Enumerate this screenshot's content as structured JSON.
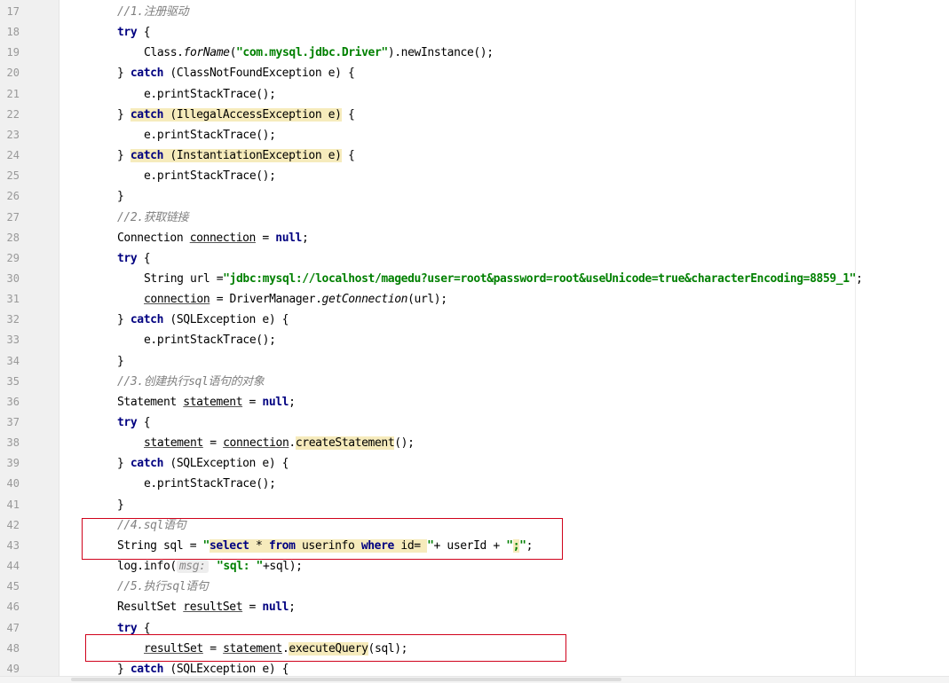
{
  "editor": {
    "lines": [
      {
        "n": "17",
        "indent": 1,
        "segs": [
          {
            "t": "//1.注册驱动",
            "c": "com"
          }
        ]
      },
      {
        "n": "18",
        "indent": 1,
        "segs": [
          {
            "t": "try",
            "c": "kw"
          },
          {
            "t": " {",
            "c": ""
          }
        ]
      },
      {
        "n": "19",
        "indent": 2,
        "segs": [
          {
            "t": "Class.",
            "c": ""
          },
          {
            "t": "forName",
            "c": "it"
          },
          {
            "t": "(",
            "c": ""
          },
          {
            "t": "\"com.mysql.jdbc.Driver\"",
            "c": "str"
          },
          {
            "t": ").newInstance();",
            "c": ""
          }
        ]
      },
      {
        "n": "20",
        "indent": 1,
        "segs": [
          {
            "t": "} ",
            "c": ""
          },
          {
            "t": "catch",
            "c": "kw"
          },
          {
            "t": " (ClassNotFoundException e) {",
            "c": ""
          }
        ]
      },
      {
        "n": "21",
        "indent": 2,
        "segs": [
          {
            "t": "e.printStackTrace();",
            "c": ""
          }
        ]
      },
      {
        "n": "22",
        "indent": 1,
        "segs": [
          {
            "t": "} ",
            "c": ""
          },
          {
            "t": "catch",
            "c": "kw hl"
          },
          {
            "t": " (IllegalAccessException e)",
            "c": "hl"
          },
          {
            "t": " {",
            "c": ""
          }
        ]
      },
      {
        "n": "23",
        "indent": 2,
        "segs": [
          {
            "t": "e.printStackTrace();",
            "c": ""
          }
        ]
      },
      {
        "n": "24",
        "indent": 1,
        "segs": [
          {
            "t": "} ",
            "c": ""
          },
          {
            "t": "catch",
            "c": "kw hl"
          },
          {
            "t": " (InstantiationException e)",
            "c": "hl"
          },
          {
            "t": " {",
            "c": ""
          }
        ]
      },
      {
        "n": "25",
        "indent": 2,
        "segs": [
          {
            "t": "e.printStackTrace();",
            "c": ""
          }
        ]
      },
      {
        "n": "26",
        "indent": 1,
        "segs": [
          {
            "t": "}",
            "c": ""
          }
        ]
      },
      {
        "n": "27",
        "indent": 1,
        "segs": [
          {
            "t": "//2.获取链接",
            "c": "com"
          }
        ]
      },
      {
        "n": "28",
        "indent": 1,
        "segs": [
          {
            "t": "Connection ",
            "c": ""
          },
          {
            "t": "connection",
            "c": "ul"
          },
          {
            "t": " = ",
            "c": ""
          },
          {
            "t": "null",
            "c": "kw"
          },
          {
            "t": ";",
            "c": ""
          }
        ]
      },
      {
        "n": "29",
        "indent": 1,
        "segs": [
          {
            "t": "try",
            "c": "kw"
          },
          {
            "t": " {",
            "c": ""
          }
        ]
      },
      {
        "n": "30",
        "indent": 2,
        "segs": [
          {
            "t": "String url =",
            "c": ""
          },
          {
            "t": "\"jdbc:mysql://localhost/magedu?user=root&password=root&useUnicode=true&characterEncoding=8859_1\"",
            "c": "str"
          },
          {
            "t": ";",
            "c": ""
          }
        ]
      },
      {
        "n": "31",
        "indent": 2,
        "segs": [
          {
            "t": "connection",
            "c": "ul"
          },
          {
            "t": " = DriverManager.",
            "c": ""
          },
          {
            "t": "getConnection",
            "c": "it"
          },
          {
            "t": "(url);",
            "c": ""
          }
        ]
      },
      {
        "n": "32",
        "indent": 1,
        "segs": [
          {
            "t": "} ",
            "c": ""
          },
          {
            "t": "catch",
            "c": "kw"
          },
          {
            "t": " (SQLException e) {",
            "c": ""
          }
        ]
      },
      {
        "n": "33",
        "indent": 2,
        "segs": [
          {
            "t": "e.printStackTrace();",
            "c": ""
          }
        ]
      },
      {
        "n": "34",
        "indent": 1,
        "segs": [
          {
            "t": "}",
            "c": ""
          }
        ]
      },
      {
        "n": "35",
        "indent": 1,
        "segs": [
          {
            "t": "//3.创建执行sql语句的对象",
            "c": "com"
          }
        ]
      },
      {
        "n": "36",
        "indent": 1,
        "segs": [
          {
            "t": "Statement ",
            "c": ""
          },
          {
            "t": "statement",
            "c": "ul"
          },
          {
            "t": " = ",
            "c": ""
          },
          {
            "t": "null",
            "c": "kw"
          },
          {
            "t": ";",
            "c": ""
          }
        ]
      },
      {
        "n": "37",
        "indent": 1,
        "segs": [
          {
            "t": "try",
            "c": "kw"
          },
          {
            "t": " {",
            "c": ""
          }
        ]
      },
      {
        "n": "38",
        "indent": 2,
        "segs": [
          {
            "t": "statement",
            "c": "ul"
          },
          {
            "t": " = ",
            "c": ""
          },
          {
            "t": "connection",
            "c": "ul"
          },
          {
            "t": ".",
            "c": ""
          },
          {
            "t": "createStatement",
            "c": "hl"
          },
          {
            "t": "();",
            "c": ""
          }
        ]
      },
      {
        "n": "39",
        "indent": 1,
        "segs": [
          {
            "t": "} ",
            "c": ""
          },
          {
            "t": "catch",
            "c": "kw"
          },
          {
            "t": " (SQLException e) {",
            "c": ""
          }
        ]
      },
      {
        "n": "40",
        "indent": 2,
        "segs": [
          {
            "t": "e.printStackTrace();",
            "c": ""
          }
        ]
      },
      {
        "n": "41",
        "indent": 1,
        "segs": [
          {
            "t": "}",
            "c": ""
          }
        ]
      },
      {
        "n": "42",
        "indent": 1,
        "segs": [
          {
            "t": "//4.sql语句",
            "c": "com"
          }
        ]
      },
      {
        "n": "43",
        "indent": 1,
        "segs": [
          {
            "t": "String sql = ",
            "c": ""
          },
          {
            "t": "\"",
            "c": "str"
          },
          {
            "t": "select",
            "c": "sqlkw hl"
          },
          {
            "t": " * ",
            "c": "hl"
          },
          {
            "t": "from",
            "c": "sqlkw hl"
          },
          {
            "t": " userinfo ",
            "c": "sqlid hl"
          },
          {
            "t": "where",
            "c": "sqlkw hl"
          },
          {
            "t": " id= ",
            "c": "sqlid hl"
          },
          {
            "t": "\"",
            "c": "str"
          },
          {
            "t": "+ userId + ",
            "c": ""
          },
          {
            "t": "\"",
            "c": "str"
          },
          {
            "t": ";",
            "c": "str hl"
          },
          {
            "t": "\"",
            "c": "str"
          },
          {
            "t": ";",
            "c": ""
          }
        ]
      },
      {
        "n": "44",
        "indent": 1,
        "segs": [
          {
            "t": "log.info(",
            "c": ""
          },
          {
            "t": "msg:",
            "c": "hint"
          },
          {
            "t": " \"sql: \"",
            "c": "str"
          },
          {
            "t": "+sql);",
            "c": ""
          }
        ]
      },
      {
        "n": "45",
        "indent": 1,
        "segs": [
          {
            "t": "//5.执行sql语句",
            "c": "com"
          }
        ]
      },
      {
        "n": "46",
        "indent": 1,
        "segs": [
          {
            "t": "ResultSet ",
            "c": ""
          },
          {
            "t": "resultSet",
            "c": "ul"
          },
          {
            "t": " = ",
            "c": ""
          },
          {
            "t": "null",
            "c": "kw"
          },
          {
            "t": ";",
            "c": ""
          }
        ]
      },
      {
        "n": "47",
        "indent": 1,
        "segs": [
          {
            "t": "try",
            "c": "kw"
          },
          {
            "t": " {",
            "c": ""
          }
        ]
      },
      {
        "n": "48",
        "indent": 2,
        "segs": [
          {
            "t": "resultSet",
            "c": "ul"
          },
          {
            "t": " = ",
            "c": ""
          },
          {
            "t": "statement",
            "c": "ul"
          },
          {
            "t": ".",
            "c": ""
          },
          {
            "t": "executeQuery",
            "c": "hl"
          },
          {
            "t": "(sql);",
            "c": ""
          }
        ]
      },
      {
        "n": "49",
        "indent": 1,
        "segs": [
          {
            "t": "} ",
            "c": ""
          },
          {
            "t": "catch",
            "c": "kw"
          },
          {
            "t": " (SQLException e) {",
            "c": ""
          }
        ]
      }
    ]
  },
  "annotations": {
    "box_color": "#d0021b"
  },
  "colors": {
    "keyword": "#000080",
    "string": "#008000",
    "comment": "#808080",
    "highlight": "#f6ebbc",
    "line_number": "#999999"
  }
}
